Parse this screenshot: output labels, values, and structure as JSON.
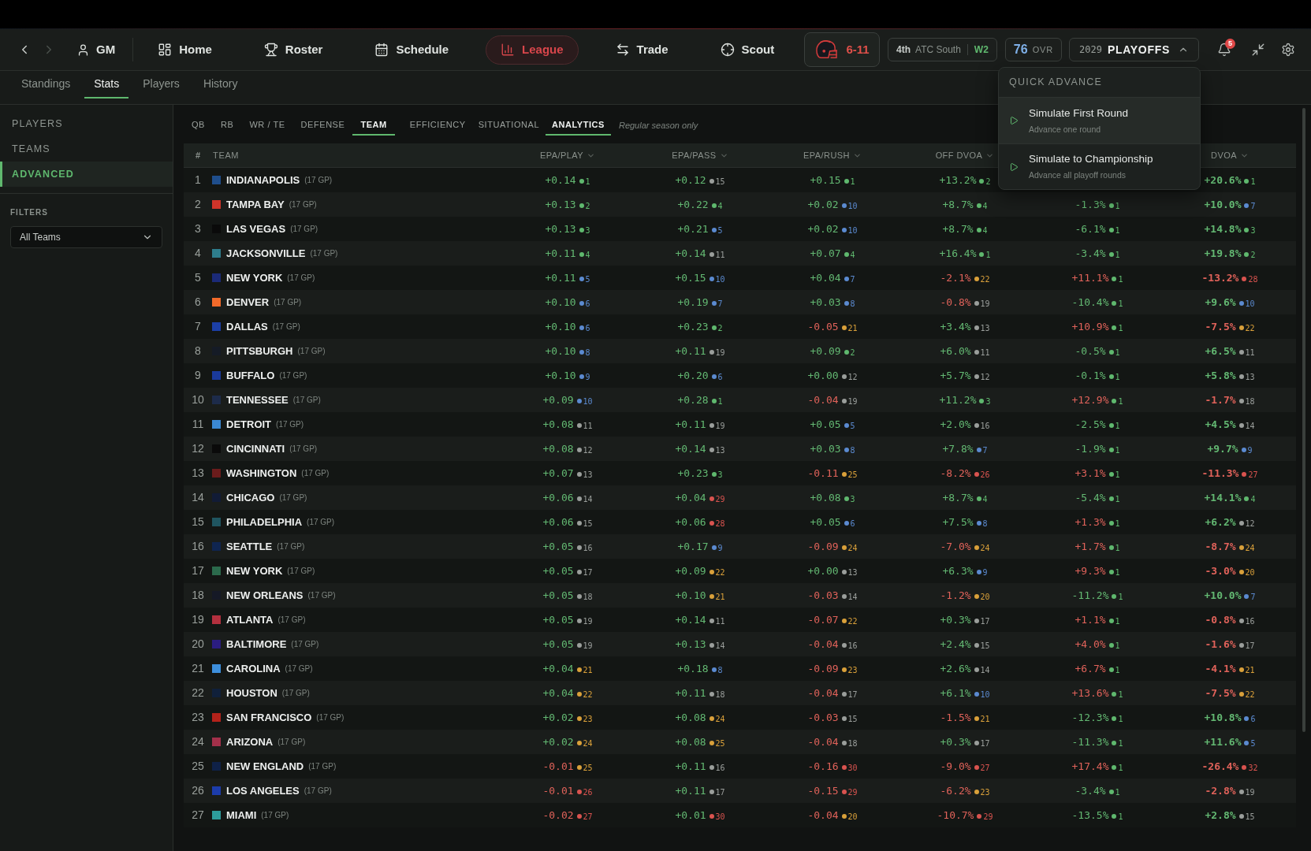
{
  "history_nav": [
    {
      "kind": "back",
      "disabled": false
    },
    {
      "kind": "forward",
      "disabled": true
    }
  ],
  "profile": {
    "label": "GM"
  },
  "nav_items": [
    {
      "label": "Home",
      "selected": false
    },
    {
      "label": "Roster",
      "selected": false
    },
    {
      "label": "Schedule",
      "selected": false
    },
    {
      "label": "League",
      "selected": true
    },
    {
      "label": "Trade",
      "selected": false
    },
    {
      "label": "Scout",
      "selected": false
    }
  ],
  "team_record": {
    "record": "6-11"
  },
  "division": {
    "place": "4th",
    "name": "ATC South",
    "streak": "W2"
  },
  "rating": {
    "value": "76",
    "label": "OVR"
  },
  "season": {
    "year": "2029",
    "phase": "PLAYOFFS",
    "expanded": true,
    "menu": {
      "title": "QUICK ADVANCE",
      "items": [
        {
          "title": "Simulate First Round",
          "subtitle": "Advance one round",
          "selected": true
        },
        {
          "title": "Simulate to Championship",
          "subtitle": "Advance all playoff rounds",
          "selected": false
        }
      ]
    }
  },
  "notifications": {
    "count": "5"
  },
  "subtabs": [
    {
      "label": "Standings",
      "selected": false
    },
    {
      "label": "Stats",
      "selected": true
    },
    {
      "label": "Players",
      "selected": false
    },
    {
      "label": "History",
      "selected": false
    }
  ],
  "sidebar": {
    "items": [
      {
        "label": "PLAYERS",
        "selected": false
      },
      {
        "label": "TEAMS",
        "selected": false
      },
      {
        "label": "ADVANCED",
        "selected": true
      }
    ],
    "filters_label": "FILTERS",
    "team_filter": {
      "value": "All Teams"
    }
  },
  "category_tabs": [
    {
      "label": "QB",
      "selected": false
    },
    {
      "label": "RB",
      "selected": false
    },
    {
      "label": "WR / TE",
      "selected": false
    },
    {
      "label": "DEFENSE",
      "selected": false
    },
    {
      "label": "TEAM",
      "selected": true
    }
  ],
  "view_tabs": [
    {
      "label": "EFFICIENCY",
      "selected": false
    },
    {
      "label": "SITUATIONAL",
      "selected": false
    },
    {
      "label": "ANALYTICS",
      "selected": true
    }
  ],
  "season_note": "Regular season only",
  "table": {
    "rank_header": "#",
    "team_header": "TEAM",
    "headers": {
      "epa_play": "EPA/PLAY",
      "epa_pass": "EPA/PASS",
      "epa_rush": "EPA/RUSH",
      "off_dvoa": "OFF DVOA",
      "dvoa": "DVOA"
    },
    "rows": [
      {
        "rank": "1",
        "team": "INDIANAPOLIS",
        "gp": "(17 GP)",
        "color": "#1f4e8c",
        "stats": {
          "epa_play": {
            "value": "+0.14",
            "favorable": true,
            "rank": "1",
            "color": "#5fb86e"
          },
          "epa_pass": {
            "value": "+0.12",
            "favorable": true,
            "rank": "15",
            "color": "#9a9e9b"
          },
          "epa_rush": {
            "value": "+0.15",
            "favorable": true,
            "rank": "1",
            "color": "#5fb86e"
          },
          "off_dvoa": {
            "value": "+13.2%",
            "favorable": true,
            "rank": "2",
            "color": "#5fb86e"
          },
          "dvoa": {
            "value": "+20.6%",
            "favorable": true,
            "rank": "1",
            "color": "#5fb86e"
          }
        }
      },
      {
        "rank": "2",
        "team": "TAMPA BAY",
        "gp": "(17 GP)",
        "color": "#d0342a",
        "stats": {
          "epa_play": {
            "value": "+0.13",
            "favorable": true,
            "rank": "2",
            "color": "#5fb86e"
          },
          "epa_pass": {
            "value": "+0.22",
            "favorable": true,
            "rank": "4",
            "color": "#5fb86e"
          },
          "epa_rush": {
            "value": "+0.02",
            "favorable": true,
            "rank": "10",
            "color": "#5b8ad0"
          },
          "off_dvoa": {
            "value": "+8.7%",
            "favorable": true,
            "rank": "4",
            "color": "#5fb86e"
          },
          "column_5": {
            "value": "-1.3%",
            "favorable": true,
            "rank": "1",
            "color": "#5fb86e"
          },
          "dvoa": {
            "value": "+10.0%",
            "favorable": true,
            "rank": "7",
            "color": "#5b8ad0"
          }
        }
      },
      {
        "rank": "3",
        "team": "LAS VEGAS",
        "gp": "(17 GP)",
        "color": "#0a0a0a",
        "stats": {
          "epa_play": {
            "value": "+0.13",
            "favorable": true,
            "rank": "3",
            "color": "#5fb86e"
          },
          "epa_pass": {
            "value": "+0.21",
            "favorable": true,
            "rank": "5",
            "color": "#5b8ad0"
          },
          "epa_rush": {
            "value": "+0.02",
            "favorable": true,
            "rank": "10",
            "color": "#5b8ad0"
          },
          "off_dvoa": {
            "value": "+8.7%",
            "favorable": true,
            "rank": "4",
            "color": "#5fb86e"
          },
          "column_5": {
            "value": "-6.1%",
            "favorable": true,
            "rank": "1",
            "color": "#5fb86e"
          },
          "dvoa": {
            "value": "+14.8%",
            "favorable": true,
            "rank": "3",
            "color": "#5fb86e"
          }
        }
      },
      {
        "rank": "4",
        "team": "JACKSONVILLE",
        "gp": "(17 GP)",
        "color": "#2e7d8c",
        "stats": {
          "epa_play": {
            "value": "+0.11",
            "favorable": true,
            "rank": "4",
            "color": "#5fb86e"
          },
          "epa_pass": {
            "value": "+0.14",
            "favorable": true,
            "rank": "11",
            "color": "#9a9e9b"
          },
          "epa_rush": {
            "value": "+0.07",
            "favorable": true,
            "rank": "4",
            "color": "#5fb86e"
          },
          "off_dvoa": {
            "value": "+16.4%",
            "favorable": true,
            "rank": "1",
            "color": "#5fb86e"
          },
          "column_5": {
            "value": "-3.4%",
            "favorable": true,
            "rank": "1",
            "color": "#5fb86e"
          },
          "dvoa": {
            "value": "+19.8%",
            "favorable": true,
            "rank": "2",
            "color": "#5fb86e"
          }
        }
      },
      {
        "rank": "5",
        "team": "NEW YORK",
        "gp": "(17 GP)",
        "color": "#1b2a78",
        "stats": {
          "epa_play": {
            "value": "+0.11",
            "favorable": true,
            "rank": "5",
            "color": "#5b8ad0"
          },
          "epa_pass": {
            "value": "+0.15",
            "favorable": true,
            "rank": "10",
            "color": "#5b8ad0"
          },
          "epa_rush": {
            "value": "+0.04",
            "favorable": true,
            "rank": "7",
            "color": "#5b8ad0"
          },
          "off_dvoa": {
            "value": "-2.1%",
            "favorable": false,
            "rank": "22",
            "color": "#d9a03a"
          },
          "column_5": {
            "value": "+11.1%",
            "favorable": false,
            "rank": "1",
            "color": "#5fb86e"
          },
          "dvoa": {
            "value": "-13.2%",
            "favorable": false,
            "rank": "28",
            "color": "#d9534f"
          }
        }
      },
      {
        "rank": "6",
        "team": "DENVER",
        "gp": "(17 GP)",
        "color": "#f26a2a",
        "stats": {
          "epa_play": {
            "value": "+0.10",
            "favorable": true,
            "rank": "6",
            "color": "#5b8ad0"
          },
          "epa_pass": {
            "value": "+0.19",
            "favorable": true,
            "rank": "7",
            "color": "#5b8ad0"
          },
          "epa_rush": {
            "value": "+0.03",
            "favorable": true,
            "rank": "8",
            "color": "#5b8ad0"
          },
          "off_dvoa": {
            "value": "-0.8%",
            "favorable": false,
            "rank": "19",
            "color": "#9a9e9b"
          },
          "column_5": {
            "value": "-10.4%",
            "favorable": true,
            "rank": "1",
            "color": "#5fb86e"
          },
          "dvoa": {
            "value": "+9.6%",
            "favorable": true,
            "rank": "10",
            "color": "#5b8ad0"
          }
        }
      },
      {
        "rank": "7",
        "team": "DALLAS",
        "gp": "(17 GP)",
        "color": "#1c3fa6",
        "stats": {
          "epa_play": {
            "value": "+0.10",
            "favorable": true,
            "rank": "6",
            "color": "#5b8ad0"
          },
          "epa_pass": {
            "value": "+0.23",
            "favorable": true,
            "rank": "2",
            "color": "#5fb86e"
          },
          "epa_rush": {
            "value": "-0.05",
            "favorable": false,
            "rank": "21",
            "color": "#d9a03a"
          },
          "off_dvoa": {
            "value": "+3.4%",
            "favorable": true,
            "rank": "13",
            "color": "#9a9e9b"
          },
          "column_5": {
            "value": "+10.9%",
            "favorable": false,
            "rank": "1",
            "color": "#5fb86e"
          },
          "dvoa": {
            "value": "-7.5%",
            "favorable": false,
            "rank": "22",
            "color": "#d9a03a"
          }
        }
      },
      {
        "rank": "8",
        "team": "PITTSBURGH",
        "gp": "(17 GP)",
        "color": "#151b26",
        "stats": {
          "epa_play": {
            "value": "+0.10",
            "favorable": true,
            "rank": "8",
            "color": "#5b8ad0"
          },
          "epa_pass": {
            "value": "+0.11",
            "favorable": true,
            "rank": "19",
            "color": "#9a9e9b"
          },
          "epa_rush": {
            "value": "+0.09",
            "favorable": true,
            "rank": "2",
            "color": "#5fb86e"
          },
          "off_dvoa": {
            "value": "+6.0%",
            "favorable": true,
            "rank": "11",
            "color": "#9a9e9b"
          },
          "column_5": {
            "value": "-0.5%",
            "favorable": true,
            "rank": "1",
            "color": "#5fb86e"
          },
          "dvoa": {
            "value": "+6.5%",
            "favorable": true,
            "rank": "11",
            "color": "#9a9e9b"
          }
        }
      },
      {
        "rank": "9",
        "team": "BUFFALO",
        "gp": "(17 GP)",
        "color": "#1a3a9c",
        "stats": {
          "epa_play": {
            "value": "+0.10",
            "favorable": true,
            "rank": "9",
            "color": "#5b8ad0"
          },
          "epa_pass": {
            "value": "+0.20",
            "favorable": true,
            "rank": "6",
            "color": "#5b8ad0"
          },
          "epa_rush": {
            "value": "+0.00",
            "favorable": true,
            "rank": "12",
            "color": "#9a9e9b"
          },
          "off_dvoa": {
            "value": "+5.7%",
            "favorable": true,
            "rank": "12",
            "color": "#9a9e9b"
          },
          "column_5": {
            "value": "-0.1%",
            "favorable": true,
            "rank": "1",
            "color": "#5fb86e"
          },
          "dvoa": {
            "value": "+5.8%",
            "favorable": true,
            "rank": "13",
            "color": "#9a9e9b"
          }
        }
      },
      {
        "rank": "10",
        "team": "TENNESSEE",
        "gp": "(17 GP)",
        "color": "#1d2b4a",
        "stats": {
          "epa_play": {
            "value": "+0.09",
            "favorable": true,
            "rank": "10",
            "color": "#5b8ad0"
          },
          "epa_pass": {
            "value": "+0.28",
            "favorable": true,
            "rank": "1",
            "color": "#5fb86e"
          },
          "epa_rush": {
            "value": "-0.04",
            "favorable": false,
            "rank": "19",
            "color": "#9a9e9b"
          },
          "off_dvoa": {
            "value": "+11.2%",
            "favorable": true,
            "rank": "3",
            "color": "#5fb86e"
          },
          "column_5": {
            "value": "+12.9%",
            "favorable": false,
            "rank": "1",
            "color": "#5fb86e"
          },
          "dvoa": {
            "value": "-1.7%",
            "favorable": false,
            "rank": "18",
            "color": "#9a9e9b"
          }
        }
      },
      {
        "rank": "11",
        "team": "DETROIT",
        "gp": "(17 GP)",
        "color": "#3b88d2",
        "stats": {
          "epa_play": {
            "value": "+0.08",
            "favorable": true,
            "rank": "11",
            "color": "#9a9e9b"
          },
          "epa_pass": {
            "value": "+0.11",
            "favorable": true,
            "rank": "19",
            "color": "#9a9e9b"
          },
          "epa_rush": {
            "value": "+0.05",
            "favorable": true,
            "rank": "5",
            "color": "#5b8ad0"
          },
          "off_dvoa": {
            "value": "+2.0%",
            "favorable": true,
            "rank": "16",
            "color": "#9a9e9b"
          },
          "column_5": {
            "value": "-2.5%",
            "favorable": true,
            "rank": "1",
            "color": "#5fb86e"
          },
          "dvoa": {
            "value": "+4.5%",
            "favorable": true,
            "rank": "14",
            "color": "#9a9e9b"
          }
        }
      },
      {
        "rank": "12",
        "team": "CINCINNATI",
        "gp": "(17 GP)",
        "color": "#0a0a0a",
        "stats": {
          "epa_play": {
            "value": "+0.08",
            "favorable": true,
            "rank": "12",
            "color": "#9a9e9b"
          },
          "epa_pass": {
            "value": "+0.14",
            "favorable": true,
            "rank": "13",
            "color": "#9a9e9b"
          },
          "epa_rush": {
            "value": "+0.03",
            "favorable": true,
            "rank": "8",
            "color": "#5b8ad0"
          },
          "off_dvoa": {
            "value": "+7.8%",
            "favorable": true,
            "rank": "7",
            "color": "#5b8ad0"
          },
          "column_5": {
            "value": "-1.9%",
            "favorable": true,
            "rank": "1",
            "color": "#5fb86e"
          },
          "dvoa": {
            "value": "+9.7%",
            "favorable": true,
            "rank": "9",
            "color": "#5b8ad0"
          }
        }
      },
      {
        "rank": "13",
        "team": "WASHINGTON",
        "gp": "(17 GP)",
        "color": "#6b1c1c",
        "stats": {
          "epa_play": {
            "value": "+0.07",
            "favorable": true,
            "rank": "13",
            "color": "#9a9e9b"
          },
          "epa_pass": {
            "value": "+0.23",
            "favorable": true,
            "rank": "3",
            "color": "#5fb86e"
          },
          "epa_rush": {
            "value": "-0.11",
            "favorable": false,
            "rank": "25",
            "color": "#d9a03a"
          },
          "off_dvoa": {
            "value": "-8.2%",
            "favorable": false,
            "rank": "26",
            "color": "#d9534f"
          },
          "column_5": {
            "value": "+3.1%",
            "favorable": false,
            "rank": "1",
            "color": "#5fb86e"
          },
          "dvoa": {
            "value": "-11.3%",
            "favorable": false,
            "rank": "27",
            "color": "#d9534f"
          }
        }
      },
      {
        "rank": "14",
        "team": "CHICAGO",
        "gp": "(17 GP)",
        "color": "#111b36",
        "stats": {
          "epa_play": {
            "value": "+0.06",
            "favorable": true,
            "rank": "14",
            "color": "#9a9e9b"
          },
          "epa_pass": {
            "value": "+0.04",
            "favorable": true,
            "rank": "29",
            "color": "#d9534f"
          },
          "epa_rush": {
            "value": "+0.08",
            "favorable": true,
            "rank": "3",
            "color": "#5fb86e"
          },
          "off_dvoa": {
            "value": "+8.7%",
            "favorable": true,
            "rank": "4",
            "color": "#5fb86e"
          },
          "column_5": {
            "value": "-5.4%",
            "favorable": true,
            "rank": "1",
            "color": "#5fb86e"
          },
          "dvoa": {
            "value": "+14.1%",
            "favorable": true,
            "rank": "4",
            "color": "#5fb86e"
          }
        }
      },
      {
        "rank": "15",
        "team": "PHILADELPHIA",
        "gp": "(17 GP)",
        "color": "#1f5560",
        "stats": {
          "epa_play": {
            "value": "+0.06",
            "favorable": true,
            "rank": "15",
            "color": "#9a9e9b"
          },
          "epa_pass": {
            "value": "+0.06",
            "favorable": true,
            "rank": "28",
            "color": "#d9534f"
          },
          "epa_rush": {
            "value": "+0.05",
            "favorable": true,
            "rank": "6",
            "color": "#5b8ad0"
          },
          "off_dvoa": {
            "value": "+7.5%",
            "favorable": true,
            "rank": "8",
            "color": "#5b8ad0"
          },
          "column_5": {
            "value": "+1.3%",
            "favorable": false,
            "rank": "1",
            "color": "#5fb86e"
          },
          "dvoa": {
            "value": "+6.2%",
            "favorable": true,
            "rank": "12",
            "color": "#9a9e9b"
          }
        }
      },
      {
        "rank": "16",
        "team": "SEATTLE",
        "gp": "(17 GP)",
        "color": "#0f2550",
        "stats": {
          "epa_play": {
            "value": "+0.05",
            "favorable": true,
            "rank": "16",
            "color": "#9a9e9b"
          },
          "epa_pass": {
            "value": "+0.17",
            "favorable": true,
            "rank": "9",
            "color": "#5b8ad0"
          },
          "epa_rush": {
            "value": "-0.09",
            "favorable": false,
            "rank": "24",
            "color": "#d9a03a"
          },
          "off_dvoa": {
            "value": "-7.0%",
            "favorable": false,
            "rank": "24",
            "color": "#d9a03a"
          },
          "column_5": {
            "value": "+1.7%",
            "favorable": false,
            "rank": "1",
            "color": "#5fb86e"
          },
          "dvoa": {
            "value": "-8.7%",
            "favorable": false,
            "rank": "24",
            "color": "#d9a03a"
          }
        }
      },
      {
        "rank": "17",
        "team": "NEW YORK",
        "gp": "(17 GP)",
        "color": "#2b6a4c",
        "stats": {
          "epa_play": {
            "value": "+0.05",
            "favorable": true,
            "rank": "17",
            "color": "#9a9e9b"
          },
          "epa_pass": {
            "value": "+0.09",
            "favorable": true,
            "rank": "22",
            "color": "#d9a03a"
          },
          "epa_rush": {
            "value": "+0.00",
            "favorable": true,
            "rank": "13",
            "color": "#9a9e9b"
          },
          "off_dvoa": {
            "value": "+6.3%",
            "favorable": true,
            "rank": "9",
            "color": "#5b8ad0"
          },
          "column_5": {
            "value": "+9.3%",
            "favorable": false,
            "rank": "1",
            "color": "#5fb86e"
          },
          "dvoa": {
            "value": "-3.0%",
            "favorable": false,
            "rank": "20",
            "color": "#d9a03a"
          }
        }
      },
      {
        "rank": "18",
        "team": "NEW ORLEANS",
        "gp": "(17 GP)",
        "color": "#151926",
        "stats": {
          "epa_play": {
            "value": "+0.05",
            "favorable": true,
            "rank": "18",
            "color": "#9a9e9b"
          },
          "epa_pass": {
            "value": "+0.10",
            "favorable": true,
            "rank": "21",
            "color": "#d9a03a"
          },
          "epa_rush": {
            "value": "-0.03",
            "favorable": false,
            "rank": "14",
            "color": "#9a9e9b"
          },
          "off_dvoa": {
            "value": "-1.2%",
            "favorable": false,
            "rank": "20",
            "color": "#d9a03a"
          },
          "column_5": {
            "value": "-11.2%",
            "favorable": true,
            "rank": "1",
            "color": "#5fb86e"
          },
          "dvoa": {
            "value": "+10.0%",
            "favorable": true,
            "rank": "7",
            "color": "#5b8ad0"
          }
        }
      },
      {
        "rank": "19",
        "team": "ATLANTA",
        "gp": "(17 GP)",
        "color": "#b3303e",
        "stats": {
          "epa_play": {
            "value": "+0.05",
            "favorable": true,
            "rank": "19",
            "color": "#9a9e9b"
          },
          "epa_pass": {
            "value": "+0.14",
            "favorable": true,
            "rank": "11",
            "color": "#9a9e9b"
          },
          "epa_rush": {
            "value": "-0.07",
            "favorable": false,
            "rank": "22",
            "color": "#d9a03a"
          },
          "off_dvoa": {
            "value": "+0.3%",
            "favorable": true,
            "rank": "17",
            "color": "#9a9e9b"
          },
          "column_5": {
            "value": "+1.1%",
            "favorable": false,
            "rank": "1",
            "color": "#5fb86e"
          },
          "dvoa": {
            "value": "-0.8%",
            "favorable": false,
            "rank": "16",
            "color": "#9a9e9b"
          }
        }
      },
      {
        "rank": "20",
        "team": "BALTIMORE",
        "gp": "(17 GP)",
        "color": "#2b1d80",
        "stats": {
          "epa_play": {
            "value": "+0.05",
            "favorable": true,
            "rank": "19",
            "color": "#9a9e9b"
          },
          "epa_pass": {
            "value": "+0.13",
            "favorable": true,
            "rank": "14",
            "color": "#9a9e9b"
          },
          "epa_rush": {
            "value": "-0.04",
            "favorable": false,
            "rank": "16",
            "color": "#9a9e9b"
          },
          "off_dvoa": {
            "value": "+2.4%",
            "favorable": true,
            "rank": "15",
            "color": "#9a9e9b"
          },
          "column_5": {
            "value": "+4.0%",
            "favorable": false,
            "rank": "1",
            "color": "#5fb86e"
          },
          "dvoa": {
            "value": "-1.6%",
            "favorable": false,
            "rank": "17",
            "color": "#9a9e9b"
          }
        }
      },
      {
        "rank": "21",
        "team": "CAROLINA",
        "gp": "(17 GP)",
        "color": "#3d8fdc",
        "stats": {
          "epa_play": {
            "value": "+0.04",
            "favorable": true,
            "rank": "21",
            "color": "#d9a03a"
          },
          "epa_pass": {
            "value": "+0.18",
            "favorable": true,
            "rank": "8",
            "color": "#5b8ad0"
          },
          "epa_rush": {
            "value": "-0.09",
            "favorable": false,
            "rank": "23",
            "color": "#d9a03a"
          },
          "off_dvoa": {
            "value": "+2.6%",
            "favorable": true,
            "rank": "14",
            "color": "#9a9e9b"
          },
          "column_5": {
            "value": "+6.7%",
            "favorable": false,
            "rank": "1",
            "color": "#5fb86e"
          },
          "dvoa": {
            "value": "-4.1%",
            "favorable": false,
            "rank": "21",
            "color": "#d9a03a"
          }
        }
      },
      {
        "rank": "22",
        "team": "HOUSTON",
        "gp": "(17 GP)",
        "color": "#10203a",
        "stats": {
          "epa_play": {
            "value": "+0.04",
            "favorable": true,
            "rank": "22",
            "color": "#d9a03a"
          },
          "epa_pass": {
            "value": "+0.11",
            "favorable": true,
            "rank": "18",
            "color": "#9a9e9b"
          },
          "epa_rush": {
            "value": "-0.04",
            "favorable": false,
            "rank": "17",
            "color": "#9a9e9b"
          },
          "off_dvoa": {
            "value": "+6.1%",
            "favorable": true,
            "rank": "10",
            "color": "#5b8ad0"
          },
          "column_5": {
            "value": "+13.6%",
            "favorable": false,
            "rank": "1",
            "color": "#5fb86e"
          },
          "dvoa": {
            "value": "-7.5%",
            "favorable": false,
            "rank": "22",
            "color": "#d9a03a"
          }
        }
      },
      {
        "rank": "23",
        "team": "SAN FRANCISCO",
        "gp": "(17 GP)",
        "color": "#b3221a",
        "stats": {
          "epa_play": {
            "value": "+0.02",
            "favorable": true,
            "rank": "23",
            "color": "#d9a03a"
          },
          "epa_pass": {
            "value": "+0.08",
            "favorable": true,
            "rank": "24",
            "color": "#d9a03a"
          },
          "epa_rush": {
            "value": "-0.03",
            "favorable": false,
            "rank": "15",
            "color": "#9a9e9b"
          },
          "off_dvoa": {
            "value": "-1.5%",
            "favorable": false,
            "rank": "21",
            "color": "#d9a03a"
          },
          "column_5": {
            "value": "-12.3%",
            "favorable": true,
            "rank": "1",
            "color": "#5fb86e"
          },
          "dvoa": {
            "value": "+10.8%",
            "favorable": true,
            "rank": "6",
            "color": "#5b8ad0"
          }
        }
      },
      {
        "rank": "24",
        "team": "ARIZONA",
        "gp": "(17 GP)",
        "color": "#a3304a",
        "stats": {
          "epa_play": {
            "value": "+0.02",
            "favorable": true,
            "rank": "24",
            "color": "#d9a03a"
          },
          "epa_pass": {
            "value": "+0.08",
            "favorable": true,
            "rank": "25",
            "color": "#d9a03a"
          },
          "epa_rush": {
            "value": "-0.04",
            "favorable": false,
            "rank": "18",
            "color": "#9a9e9b"
          },
          "off_dvoa": {
            "value": "+0.3%",
            "favorable": true,
            "rank": "17",
            "color": "#9a9e9b"
          },
          "column_5": {
            "value": "-11.3%",
            "favorable": true,
            "rank": "1",
            "color": "#5fb86e"
          },
          "dvoa": {
            "value": "+11.6%",
            "favorable": true,
            "rank": "5",
            "color": "#5b8ad0"
          }
        }
      },
      {
        "rank": "25",
        "team": "NEW ENGLAND",
        "gp": "(17 GP)",
        "color": "#0f2148",
        "stats": {
          "epa_play": {
            "value": "-0.01",
            "favorable": false,
            "rank": "25",
            "color": "#d9a03a"
          },
          "epa_pass": {
            "value": "+0.11",
            "favorable": true,
            "rank": "16",
            "color": "#9a9e9b"
          },
          "epa_rush": {
            "value": "-0.16",
            "favorable": false,
            "rank": "30",
            "color": "#d9534f"
          },
          "off_dvoa": {
            "value": "-9.0%",
            "favorable": false,
            "rank": "27",
            "color": "#d9534f"
          },
          "column_5": {
            "value": "+17.4%",
            "favorable": false,
            "rank": "1",
            "color": "#5fb86e"
          },
          "dvoa": {
            "value": "-26.4%",
            "favorable": false,
            "rank": "32",
            "color": "#d9534f"
          }
        }
      },
      {
        "rank": "26",
        "team": "LOS ANGELES",
        "gp": "(17 GP)",
        "color": "#1c3cab",
        "stats": {
          "epa_play": {
            "value": "-0.01",
            "favorable": false,
            "rank": "26",
            "color": "#d9534f"
          },
          "epa_pass": {
            "value": "+0.11",
            "favorable": true,
            "rank": "17",
            "color": "#9a9e9b"
          },
          "epa_rush": {
            "value": "-0.15",
            "favorable": false,
            "rank": "29",
            "color": "#d9534f"
          },
          "off_dvoa": {
            "value": "-6.2%",
            "favorable": false,
            "rank": "23",
            "color": "#d9a03a"
          },
          "column_5": {
            "value": "-3.4%",
            "favorable": true,
            "rank": "1",
            "color": "#5fb86e"
          },
          "dvoa": {
            "value": "-2.8%",
            "favorable": false,
            "rank": "19",
            "color": "#9a9e9b"
          }
        }
      },
      {
        "rank": "27",
        "team": "MIAMI",
        "gp": "(17 GP)",
        "color": "#2d9c9c",
        "stats": {
          "epa_play": {
            "value": "-0.02",
            "favorable": false,
            "rank": "27",
            "color": "#d9534f"
          },
          "epa_pass": {
            "value": "+0.01",
            "favorable": true,
            "rank": "30",
            "color": "#d9534f"
          },
          "epa_rush": {
            "value": "-0.04",
            "favorable": false,
            "rank": "20",
            "color": "#d9a03a"
          },
          "off_dvoa": {
            "value": "-10.7%",
            "favorable": false,
            "rank": "29",
            "color": "#d9534f"
          },
          "column_5": {
            "value": "-13.5%",
            "favorable": true,
            "rank": "1",
            "color": "#5fb86e"
          },
          "dvoa": {
            "value": "+2.8%",
            "favorable": true,
            "rank": "15",
            "color": "#9a9e9b"
          }
        }
      }
    ]
  }
}
